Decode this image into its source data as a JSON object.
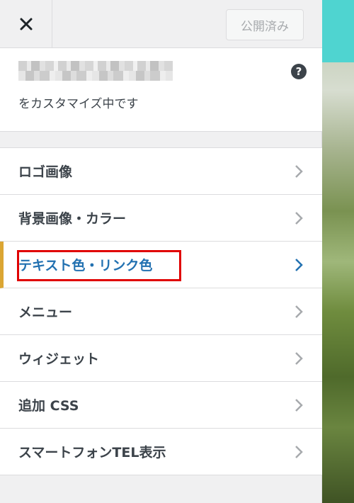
{
  "header": {
    "close_icon": "close-icon",
    "publish_label": "公開済み"
  },
  "info": {
    "subtitle": "をカスタマイズ中です",
    "help_icon": "question-circle-icon",
    "help_glyph": "?"
  },
  "menu": {
    "items": [
      {
        "label": "ロゴ画像"
      },
      {
        "label": "背景画像・カラー"
      },
      {
        "label": "テキスト色・リンク色"
      },
      {
        "label": "メニュー"
      },
      {
        "label": "ウィジェット"
      },
      {
        "label": "追加 CSS"
      },
      {
        "label": "スマートフォンTEL表示"
      }
    ],
    "active_index": 2
  },
  "colors": {
    "accent": "#2271b1",
    "active_border": "#dba633",
    "highlight": "#e00000",
    "preview_top": "#4fd4d0"
  }
}
